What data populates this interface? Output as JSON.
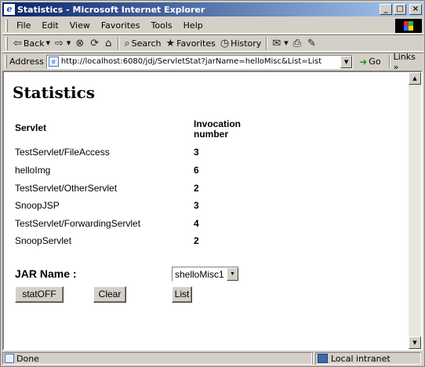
{
  "window": {
    "title": "Statistics - Microsoft Internet Explorer"
  },
  "menu": [
    "File",
    "Edit",
    "View",
    "Favorites",
    "Tools",
    "Help"
  ],
  "toolbar": {
    "back": "Back",
    "search": "Search",
    "favorites": "Favorites",
    "history": "History"
  },
  "address": {
    "label": "Address",
    "url": "http://localhost:6080/jdj/ServletStat?jarName=helloMisc&List=List",
    "go": "Go",
    "links": "Links"
  },
  "page": {
    "title": "Statistics",
    "headers": {
      "servlet": "Servlet",
      "invocation_line1": "Invocation",
      "invocation_line2": "number"
    },
    "rows": [
      {
        "name": "TestServlet/FileAccess",
        "count": "3"
      },
      {
        "name": "helloImg",
        "count": "6"
      },
      {
        "name": "TestServlet/OtherServlet",
        "count": "2"
      },
      {
        "name": "SnoopJSP",
        "count": "3"
      },
      {
        "name": "TestServlet/ForwardingServlet",
        "count": "4"
      },
      {
        "name": "SnoopServlet",
        "count": "2"
      }
    ],
    "jar_label": "JAR Name :",
    "jar_selected": "shelloMisc1",
    "buttons": {
      "stat_off": "statOFF",
      "clear": "Clear",
      "list": "List"
    }
  },
  "status": {
    "text": "Done",
    "zone": "Local intranet"
  }
}
